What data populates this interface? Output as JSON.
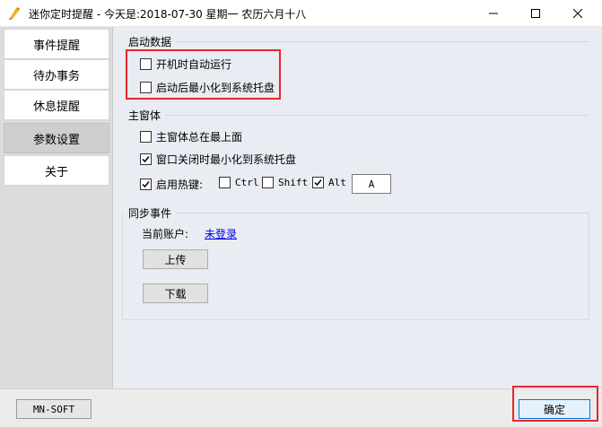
{
  "window": {
    "title": "迷你定时提醒 - 今天是:2018-07-30 星期一 农历六月十八"
  },
  "sidebar": {
    "items": [
      {
        "label": "事件提醒"
      },
      {
        "label": "待办事务"
      },
      {
        "label": "休息提醒"
      },
      {
        "label": "参数设置",
        "active": true
      },
      {
        "label": "关于"
      }
    ]
  },
  "startup": {
    "title": "启动数据",
    "autorun": {
      "label": "开机时自动运行",
      "checked": false
    },
    "minimize_tray": {
      "label": "启动后最小化到系统托盘",
      "checked": false
    }
  },
  "mainwindow": {
    "title": "主窗体",
    "always_on_top": {
      "label": "主窗体总在最上面",
      "checked": false
    },
    "close_to_tray": {
      "label": "窗口关闭时最小化到系统托盘",
      "checked": true
    },
    "hotkey": {
      "label": "启用热键:",
      "checked": true,
      "ctrl": {
        "label": "Ctrl",
        "checked": false
      },
      "shift": {
        "label": "Shift",
        "checked": false
      },
      "alt": {
        "label": "Alt",
        "checked": true
      },
      "key_value": "A"
    }
  },
  "sync": {
    "title": "同步事件",
    "account_label": "当前账户:",
    "account_link": "未登录",
    "upload_label": "上传",
    "download_label": "下载"
  },
  "footer": {
    "brand_label": "MN-SOFT",
    "ok_label": "确定"
  },
  "colors": {
    "highlight": "#e8262b",
    "link": "#0000ee",
    "ok_border": "#0078d7"
  }
}
